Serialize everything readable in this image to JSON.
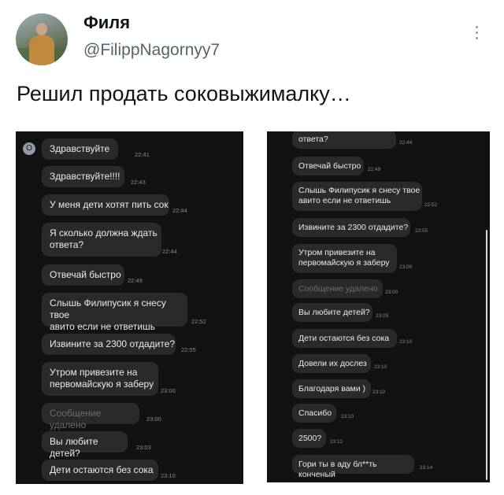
{
  "author": {
    "name": "Филя",
    "handle": "@FilippNagornyy7"
  },
  "tweet": {
    "text": "Решил продать соковыжималку…"
  },
  "left_chat": {
    "avatar_letter": "О",
    "messages": [
      {
        "text": "Здравствуйте",
        "time": "22:41"
      },
      {
        "text": "Здравствуйте!!!!",
        "time": "22:43"
      },
      {
        "text": "У меня дети хотят пить сок",
        "time": "22:44"
      },
      {
        "text": "Я сколько должна ждать\nответа?",
        "time": "22:44"
      },
      {
        "text": "Отвечай быстро",
        "time": "22:49"
      },
      {
        "text": "Слышь Филипусик я снесу твое\nавито если не ответишь",
        "time": "22:52"
      },
      {
        "text": "Извините за 2300 отдадите?",
        "time": "22:55"
      },
      {
        "text": "Утром привезите на\nпервомайскую я заберу",
        "time": "23:00"
      },
      {
        "text": "Сообщение удалено",
        "time": "23:00"
      },
      {
        "text": "Вы любите детей?",
        "time": "23:03"
      },
      {
        "text": "Дети остаются без сока",
        "time": "23:10"
      }
    ]
  },
  "right_chat": {
    "messages": [
      {
        "text": "ответа?",
        "time": "22:44"
      },
      {
        "text": "Отвечай быстро",
        "time": "22:49"
      },
      {
        "text": "Слышь Филипусик я снесу твое\nавито если не ответишь",
        "time": "22:52"
      },
      {
        "text": "Извините за 2300 отдадите?",
        "time": "22:55"
      },
      {
        "text": "Утром привезите на\nпервомайскую я заберу",
        "time": "23:00"
      },
      {
        "text": "Сообщение удалено",
        "time": "23:00"
      },
      {
        "text": "Вы любите детей?",
        "time": "23:03"
      },
      {
        "text": "Дети остаются без сока",
        "time": "23:10"
      },
      {
        "text": "Довели их дослез",
        "time": "23:10"
      },
      {
        "text": "Благодаря вами )",
        "time": "23:10"
      },
      {
        "text": "Спасибо",
        "time": "23:10"
      },
      {
        "text": "2500?",
        "time": "23:12"
      },
      {
        "text": "Гори ты в аду бл**ть конченый",
        "time": "23:14"
      }
    ]
  }
}
